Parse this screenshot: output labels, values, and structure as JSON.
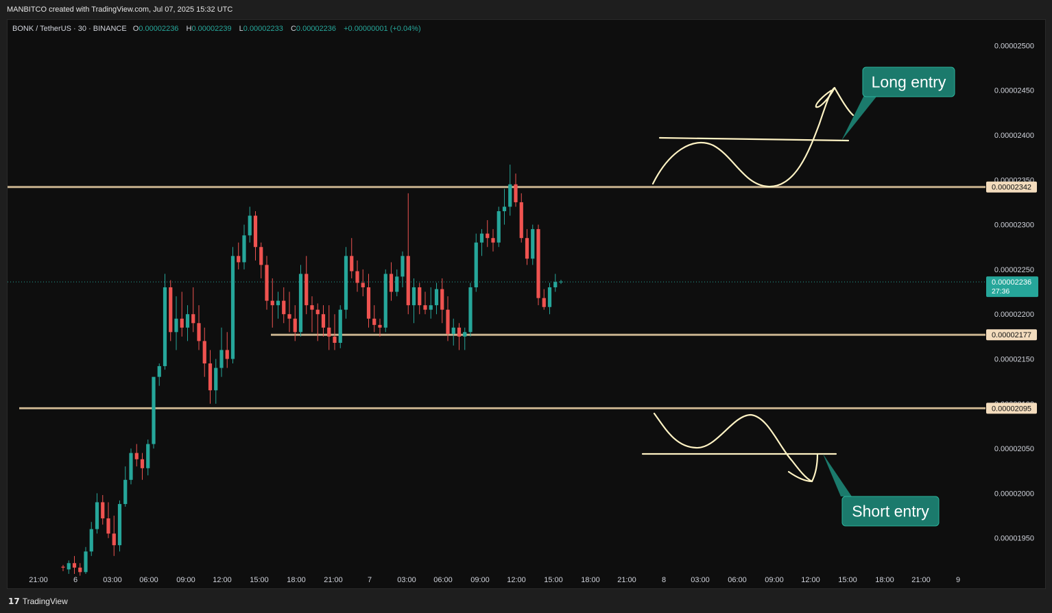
{
  "header": {
    "credit": "MANBITCO created with TradingView.com, Jul 07, 2025 15:32 UTC"
  },
  "legend": {
    "symbol": "BONK / TetherUS · 30 · BINANCE",
    "open_label": "O",
    "open": "0.00002236",
    "high_label": "H",
    "high": "0.00002239",
    "low_label": "L",
    "low": "0.00002233",
    "close_label": "C",
    "close": "0.00002236",
    "change": "+0.00000001 (+0.04%)"
  },
  "footer": {
    "brand_mark": "17",
    "brand": "TradingView"
  },
  "colors": {
    "up": "#26a69a",
    "down": "#ef5350",
    "level_line": "#c8b28e",
    "drawing": "#fff3c4",
    "callout": "#1b7a6c",
    "background": "#0e0e0e"
  },
  "chart_data": {
    "type": "candlestick",
    "ylim": [
      1.91e-05,
      2.54e-05
    ],
    "y_ticks": [
      "0.00002500",
      "0.00002450",
      "0.00002400",
      "0.00002350",
      "0.00002300",
      "0.00002250",
      "0.00002200",
      "0.00002150",
      "0.00002100",
      "0.00002050",
      "0.00002000",
      "0.00001950"
    ],
    "x_ticks": [
      "21:00",
      "6",
      "03:00",
      "06:00",
      "09:00",
      "12:00",
      "15:00",
      "18:00",
      "21:00",
      "7",
      "03:00",
      "06:00",
      "09:00",
      "12:00",
      "15:00",
      "18:00",
      "21:00",
      "8",
      "03:00",
      "06:00",
      "09:00",
      "12:00",
      "15:00",
      "18:00",
      "21:00",
      "9"
    ],
    "levels": [
      {
        "price": 2.342e-05,
        "label": "0.00002342"
      },
      {
        "price": 2.177e-05,
        "label": "0.00002177"
      },
      {
        "price": 2.095e-05,
        "label": "0.00002095"
      }
    ],
    "current_price": {
      "price": 2.236e-05,
      "label": "0.00002236",
      "countdown": "27:36"
    },
    "annotations": [
      "Long entry",
      "Short entry"
    ],
    "candles": [
      {
        "o": 1.918,
        "h": 1.92,
        "l": 1.913,
        "c": 1.917
      },
      {
        "o": 1.915,
        "h": 1.925,
        "l": 1.91,
        "c": 1.922
      },
      {
        "o": 1.922,
        "h": 1.93,
        "l": 1.91,
        "c": 1.917
      },
      {
        "o": 1.917,
        "h": 1.922,
        "l": 1.908,
        "c": 1.912
      },
      {
        "o": 1.912,
        "h": 1.94,
        "l": 1.91,
        "c": 1.935
      },
      {
        "o": 1.935,
        "h": 1.968,
        "l": 1.93,
        "c": 1.96
      },
      {
        "o": 1.96,
        "h": 2.0,
        "l": 1.955,
        "c": 1.99
      },
      {
        "o": 1.99,
        "h": 1.998,
        "l": 1.965,
        "c": 1.972
      },
      {
        "o": 1.972,
        "h": 1.99,
        "l": 1.95,
        "c": 1.955
      },
      {
        "o": 1.955,
        "h": 1.975,
        "l": 1.93,
        "c": 1.942
      },
      {
        "o": 1.942,
        "h": 1.992,
        "l": 1.935,
        "c": 1.988
      },
      {
        "o": 1.988,
        "h": 2.03,
        "l": 1.985,
        "c": 2.015
      },
      {
        "o": 2.015,
        "h": 2.05,
        "l": 2.01,
        "c": 2.045
      },
      {
        "o": 2.045,
        "h": 2.055,
        "l": 2.03,
        "c": 2.038
      },
      {
        "o": 2.038,
        "h": 2.045,
        "l": 2.015,
        "c": 2.028
      },
      {
        "o": 2.028,
        "h": 2.06,
        "l": 2.02,
        "c": 2.055
      },
      {
        "o": 2.055,
        "h": 2.115,
        "l": 2.05,
        "c": 2.13
      },
      {
        "o": 2.13,
        "h": 2.145,
        "l": 2.12,
        "c": 2.142
      },
      {
        "o": 2.142,
        "h": 2.245,
        "l": 2.138,
        "c": 2.23
      },
      {
        "o": 2.23,
        "h": 2.238,
        "l": 2.17,
        "c": 2.18
      },
      {
        "o": 2.18,
        "h": 2.22,
        "l": 2.16,
        "c": 2.195
      },
      {
        "o": 2.195,
        "h": 2.225,
        "l": 2.175,
        "c": 2.185
      },
      {
        "o": 2.185,
        "h": 2.21,
        "l": 2.17,
        "c": 2.2
      },
      {
        "o": 2.2,
        "h": 2.23,
        "l": 2.18,
        "c": 2.19
      },
      {
        "o": 2.19,
        "h": 2.21,
        "l": 2.16,
        "c": 2.17
      },
      {
        "o": 2.17,
        "h": 2.185,
        "l": 2.13,
        "c": 2.145
      },
      {
        "o": 2.145,
        "h": 2.16,
        "l": 2.1,
        "c": 2.115
      },
      {
        "o": 2.115,
        "h": 2.15,
        "l": 2.1,
        "c": 2.14
      },
      {
        "o": 2.14,
        "h": 2.185,
        "l": 2.13,
        "c": 2.16
      },
      {
        "o": 2.16,
        "h": 2.18,
        "l": 2.14,
        "c": 2.15
      },
      {
        "o": 2.15,
        "h": 2.275,
        "l": 2.145,
        "c": 2.265
      },
      {
        "o": 2.265,
        "h": 2.28,
        "l": 2.25,
        "c": 2.258
      },
      {
        "o": 2.258,
        "h": 2.3,
        "l": 2.25,
        "c": 2.288
      },
      {
        "o": 2.288,
        "h": 2.32,
        "l": 2.28,
        "c": 2.31
      },
      {
        "o": 2.31,
        "h": 2.315,
        "l": 2.26,
        "c": 2.275
      },
      {
        "o": 2.275,
        "h": 2.28,
        "l": 2.24,
        "c": 2.255
      },
      {
        "o": 2.255,
        "h": 2.265,
        "l": 2.205,
        "c": 2.215
      },
      {
        "o": 2.215,
        "h": 2.24,
        "l": 2.185,
        "c": 2.21
      },
      {
        "o": 2.21,
        "h": 2.225,
        "l": 2.195,
        "c": 2.215
      },
      {
        "o": 2.215,
        "h": 2.23,
        "l": 2.19,
        "c": 2.2
      },
      {
        "o": 2.2,
        "h": 2.225,
        "l": 2.18,
        "c": 2.195
      },
      {
        "o": 2.195,
        "h": 2.21,
        "l": 2.17,
        "c": 2.18
      },
      {
        "o": 2.18,
        "h": 2.255,
        "l": 2.175,
        "c": 2.245
      },
      {
        "o": 2.245,
        "h": 2.265,
        "l": 2.2,
        "c": 2.21
      },
      {
        "o": 2.21,
        "h": 2.22,
        "l": 2.18,
        "c": 2.205
      },
      {
        "o": 2.205,
        "h": 2.212,
        "l": 2.17,
        "c": 2.2
      },
      {
        "o": 2.2,
        "h": 2.21,
        "l": 2.175,
        "c": 2.185
      },
      {
        "o": 2.185,
        "h": 2.21,
        "l": 2.16,
        "c": 2.175
      },
      {
        "o": 2.175,
        "h": 2.2,
        "l": 2.16,
        "c": 2.168
      },
      {
        "o": 2.168,
        "h": 2.21,
        "l": 2.162,
        "c": 2.205
      },
      {
        "o": 2.205,
        "h": 2.275,
        "l": 2.195,
        "c": 2.265
      },
      {
        "o": 2.265,
        "h": 2.285,
        "l": 2.24,
        "c": 2.248
      },
      {
        "o": 2.248,
        "h": 2.26,
        "l": 2.225,
        "c": 2.235
      },
      {
        "o": 2.235,
        "h": 2.25,
        "l": 2.22,
        "c": 2.23
      },
      {
        "o": 2.23,
        "h": 2.245,
        "l": 2.185,
        "c": 2.195
      },
      {
        "o": 2.195,
        "h": 2.21,
        "l": 2.18,
        "c": 2.188
      },
      {
        "o": 2.188,
        "h": 2.195,
        "l": 2.175,
        "c": 2.185
      },
      {
        "o": 2.185,
        "h": 2.25,
        "l": 2.18,
        "c": 2.245
      },
      {
        "o": 2.245,
        "h": 2.258,
        "l": 2.215,
        "c": 2.225
      },
      {
        "o": 2.225,
        "h": 2.25,
        "l": 2.22,
        "c": 2.242
      },
      {
        "o": 2.242,
        "h": 2.27,
        "l": 2.23,
        "c": 2.265
      },
      {
        "o": 2.265,
        "h": 2.335,
        "l": 2.2,
        "c": 2.21
      },
      {
        "o": 2.21,
        "h": 2.24,
        "l": 2.19,
        "c": 2.23
      },
      {
        "o": 2.23,
        "h": 2.235,
        "l": 2.2,
        "c": 2.21
      },
      {
        "o": 2.21,
        "h": 2.225,
        "l": 2.2,
        "c": 2.205
      },
      {
        "o": 2.205,
        "h": 2.23,
        "l": 2.195,
        "c": 2.21
      },
      {
        "o": 2.21,
        "h": 2.235,
        "l": 2.2,
        "c": 2.228
      },
      {
        "o": 2.228,
        "h": 2.24,
        "l": 2.19,
        "c": 2.205
      },
      {
        "o": 2.205,
        "h": 2.22,
        "l": 2.17,
        "c": 2.178
      },
      {
        "o": 2.178,
        "h": 2.195,
        "l": 2.165,
        "c": 2.185
      },
      {
        "o": 2.185,
        "h": 2.19,
        "l": 2.16,
        "c": 2.175
      },
      {
        "o": 2.175,
        "h": 2.185,
        "l": 2.16,
        "c": 2.18
      },
      {
        "o": 2.18,
        "h": 2.235,
        "l": 2.175,
        "c": 2.23
      },
      {
        "o": 2.23,
        "h": 2.29,
        "l": 2.225,
        "c": 2.28
      },
      {
        "o": 2.28,
        "h": 2.295,
        "l": 2.265,
        "c": 2.29
      },
      {
        "o": 2.29,
        "h": 2.305,
        "l": 2.275,
        "c": 2.285
      },
      {
        "o": 2.285,
        "h": 2.295,
        "l": 2.27,
        "c": 2.28
      },
      {
        "o": 2.28,
        "h": 2.32,
        "l": 2.275,
        "c": 2.315
      },
      {
        "o": 2.315,
        "h": 2.34,
        "l": 2.3,
        "c": 2.32
      },
      {
        "o": 2.32,
        "h": 2.367,
        "l": 2.31,
        "c": 2.345
      },
      {
        "o": 2.345,
        "h": 2.357,
        "l": 2.32,
        "c": 2.325
      },
      {
        "o": 2.325,
        "h": 2.335,
        "l": 2.28,
        "c": 2.285
      },
      {
        "o": 2.285,
        "h": 2.295,
        "l": 2.255,
        "c": 2.262
      },
      {
        "o": 2.262,
        "h": 2.3,
        "l": 2.255,
        "c": 2.295
      },
      {
        "o": 2.295,
        "h": 2.3,
        "l": 2.21,
        "c": 2.218
      },
      {
        "o": 2.218,
        "h": 2.228,
        "l": 2.205,
        "c": 2.208
      },
      {
        "o": 2.208,
        "h": 2.235,
        "l": 2.2,
        "c": 2.23
      },
      {
        "o": 2.23,
        "h": 2.245,
        "l": 2.225,
        "c": 2.236
      }
    ]
  }
}
